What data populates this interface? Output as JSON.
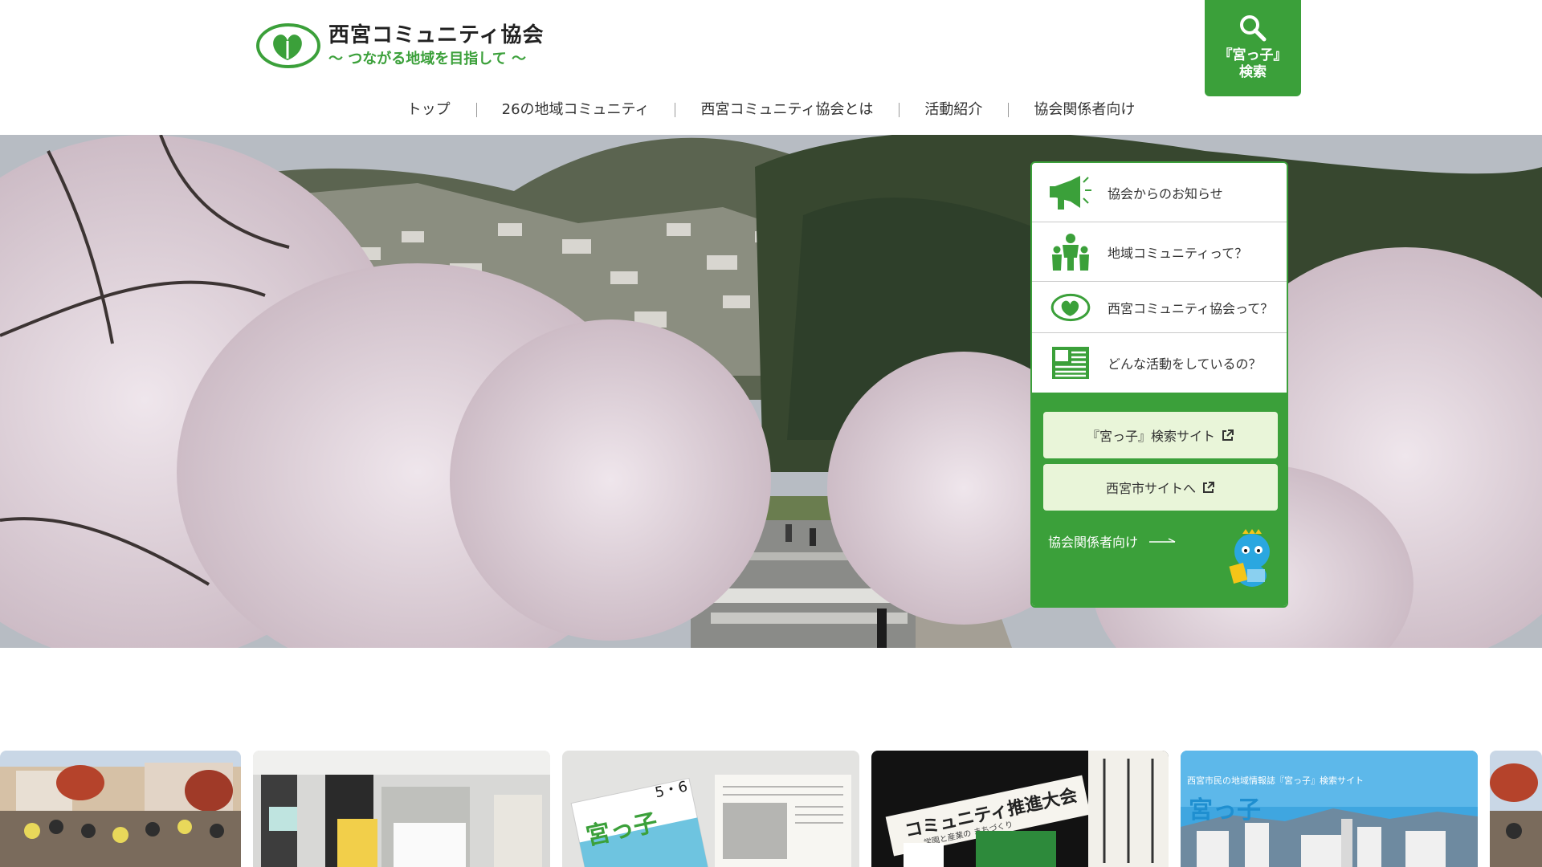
{
  "header": {
    "logo_title": "西宮コミュニティ協会",
    "logo_tagline": "〜 つながる地域を目指して 〜",
    "search_label": "『宮っ子』",
    "search_sub": "検索"
  },
  "nav": {
    "items": [
      "トップ",
      "26の地域コミュニティ",
      "西宮コミュニティ協会とは",
      "活動紹介",
      "協会関係者向け"
    ]
  },
  "side_panel": {
    "items": [
      {
        "label": "協会からのお知らせ",
        "icon": "megaphone-icon"
      },
      {
        "label": "地域コミュニティって？",
        "icon": "people-icon"
      },
      {
        "label": "西宮コミュニティ協会って？",
        "icon": "logo-icon"
      },
      {
        "label": "どんな活動をしているの？",
        "icon": "newspaper-icon"
      }
    ],
    "btn_search": "『宮っ子』検索サイト",
    "btn_city": "西宮市サイトへ",
    "staff_link": "協会関係者向け"
  },
  "cards": {
    "card5_caption": "西宮市民の地域情報誌『宮っ子』検索サイト",
    "card3_text": "宮っ子",
    "card3_issue": "5・6",
    "card4_banner": "コミュニティ推進大会",
    "card4_sub": "学園と産業の まちづくり",
    "card5_logo": "宮っ子"
  },
  "colors": {
    "brand_green": "#3ba03a",
    "light_green": "#e9f5d9"
  }
}
